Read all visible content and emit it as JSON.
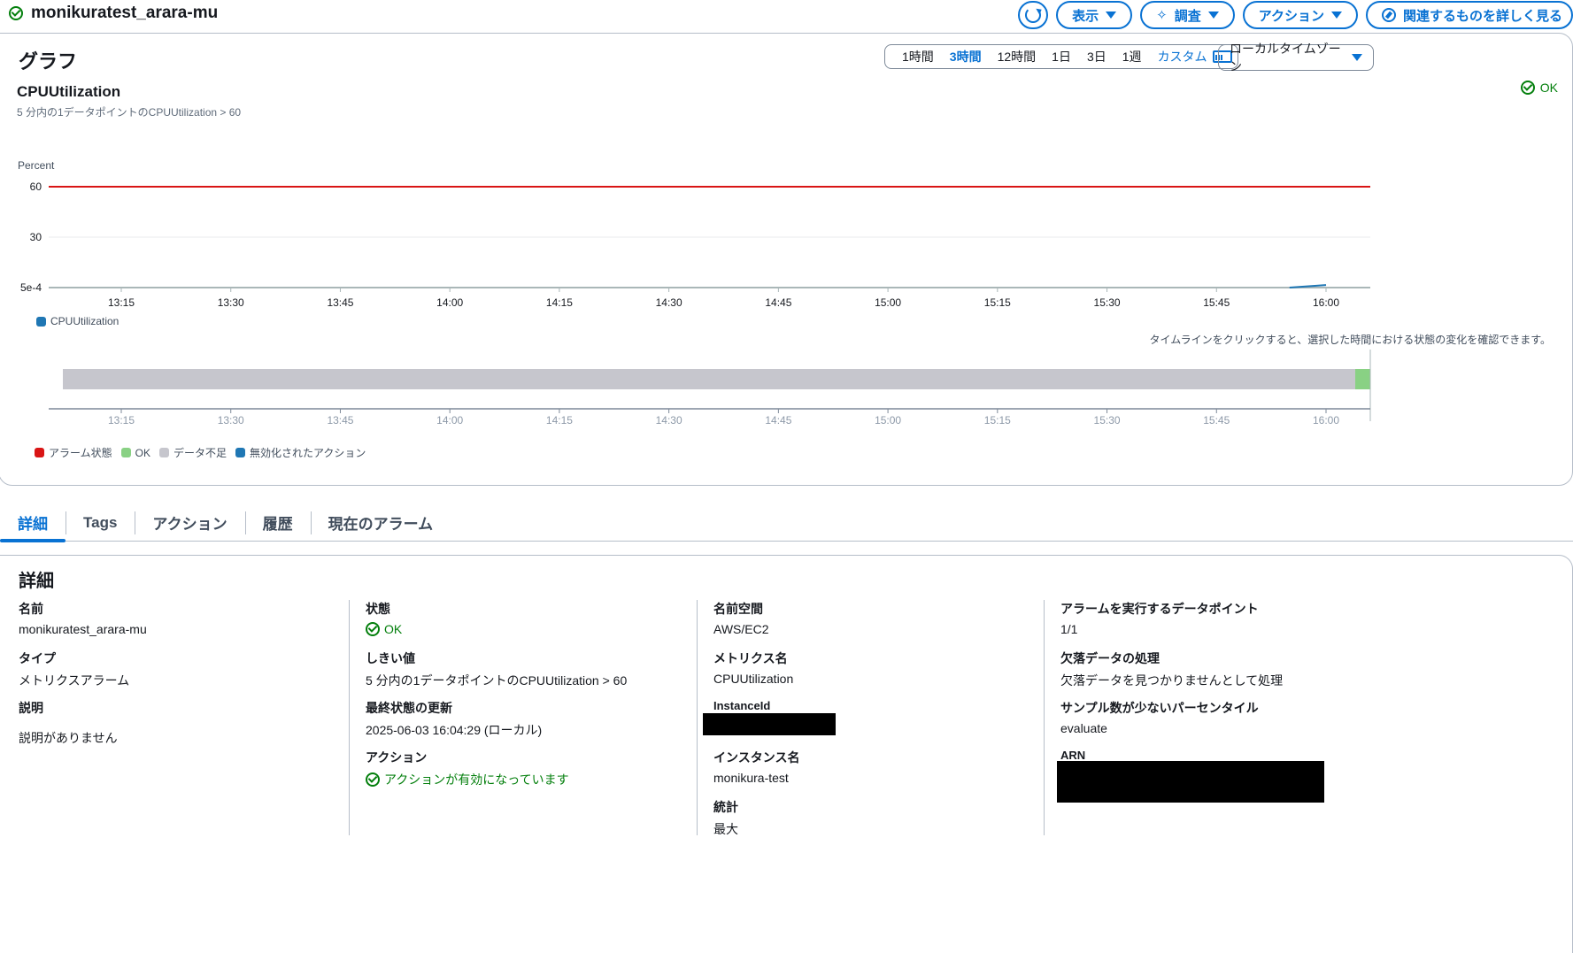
{
  "header": {
    "alarm_name": "monikuratest_arara-mu",
    "buttons": {
      "view": "表示",
      "investigate": "調査",
      "actions": "アクション",
      "explore": "関連するものを詳しく見る"
    }
  },
  "graph": {
    "title": "グラフ",
    "ranges": [
      "1時間",
      "3時間",
      "12時間",
      "1日",
      "3日",
      "1週"
    ],
    "active_range": "3時間",
    "custom_label": "カスタム",
    "timezone": "ローカルタイムゾーン",
    "metric_title": "CPUUtilization",
    "metric_subtitle": "5 分内の1データポイントのCPUUtilization > 60",
    "status": "OK",
    "timeline_hint": "タイムラインをクリックすると、選択した時間における状態の変化を確認できます。",
    "state_legend": [
      {
        "label": "アラーム状態",
        "color": "#d91515"
      },
      {
        "label": "OK",
        "color": "#89d184"
      },
      {
        "label": "データ不足",
        "color": "#c6c6cd"
      },
      {
        "label": "無効化されたアクション",
        "color": "#1f77b4"
      }
    ]
  },
  "chart_data": {
    "type": "line",
    "ylabel": "Percent",
    "y_ticks": [
      "60",
      "30",
      "5e-4"
    ],
    "x_ticks": [
      "13:15",
      "13:30",
      "13:45",
      "14:00",
      "14:15",
      "14:30",
      "14:45",
      "15:00",
      "15:15",
      "15:30",
      "15:45",
      "16:00"
    ],
    "threshold": 60,
    "threshold_color": "#d91515",
    "series": [
      {
        "name": "CPUUtilization",
        "color": "#1f77b4",
        "x": [
          "15:55",
          "16:00"
        ],
        "values": [
          0.0005,
          1.5
        ]
      }
    ],
    "timeline": {
      "x_ticks": [
        "13:15",
        "13:30",
        "13:45",
        "14:00",
        "14:15",
        "14:30",
        "14:45",
        "15:00",
        "15:15",
        "15:30",
        "15:45",
        "16:00"
      ],
      "segments": [
        {
          "state": "データ不足",
          "color": "#c6c6cd",
          "from": "13:07",
          "to": "16:04"
        },
        {
          "state": "OK",
          "color": "#89d184",
          "from": "16:04",
          "to": "16:06"
        }
      ]
    }
  },
  "tabs": [
    "詳細",
    "Tags",
    "アクション",
    "履歴",
    "現在のアラーム"
  ],
  "details": {
    "title": "詳細",
    "col1": [
      {
        "k": "名前",
        "v": "monikuratest_arara-mu"
      },
      {
        "k": "タイプ",
        "v": "メトリクスアラーム"
      },
      {
        "k": "説明",
        "v": "説明がありません"
      }
    ],
    "col2": [
      {
        "k": "状態",
        "v": "OK"
      },
      {
        "k": "しきい値",
        "v": "5 分内の1データポイントのCPUUtilization > 60"
      },
      {
        "k": "最終状態の更新",
        "v": "2025-06-03 16:04:29 (ローカル)"
      },
      {
        "k": "アクション",
        "v": "アクションが有効になっています"
      }
    ],
    "col3": [
      {
        "k": "名前空間",
        "v": "AWS/EC2"
      },
      {
        "k": "メトリクス名",
        "v": "CPUUtilization"
      },
      {
        "k": "InstanceId",
        "v": ""
      },
      {
        "k": "インスタンス名",
        "v": "monikura-test"
      },
      {
        "k": "統計",
        "v": "最大"
      }
    ],
    "col4": [
      {
        "k": "アラームを実行するデータポイント",
        "v": "1/1"
      },
      {
        "k": "欠落データの処理",
        "v": "欠落データを見つかりませんとして処理"
      },
      {
        "k": "サンプル数が少ないパーセンタイル",
        "v": "evaluate"
      },
      {
        "k": "ARN",
        "v": ""
      }
    ]
  }
}
